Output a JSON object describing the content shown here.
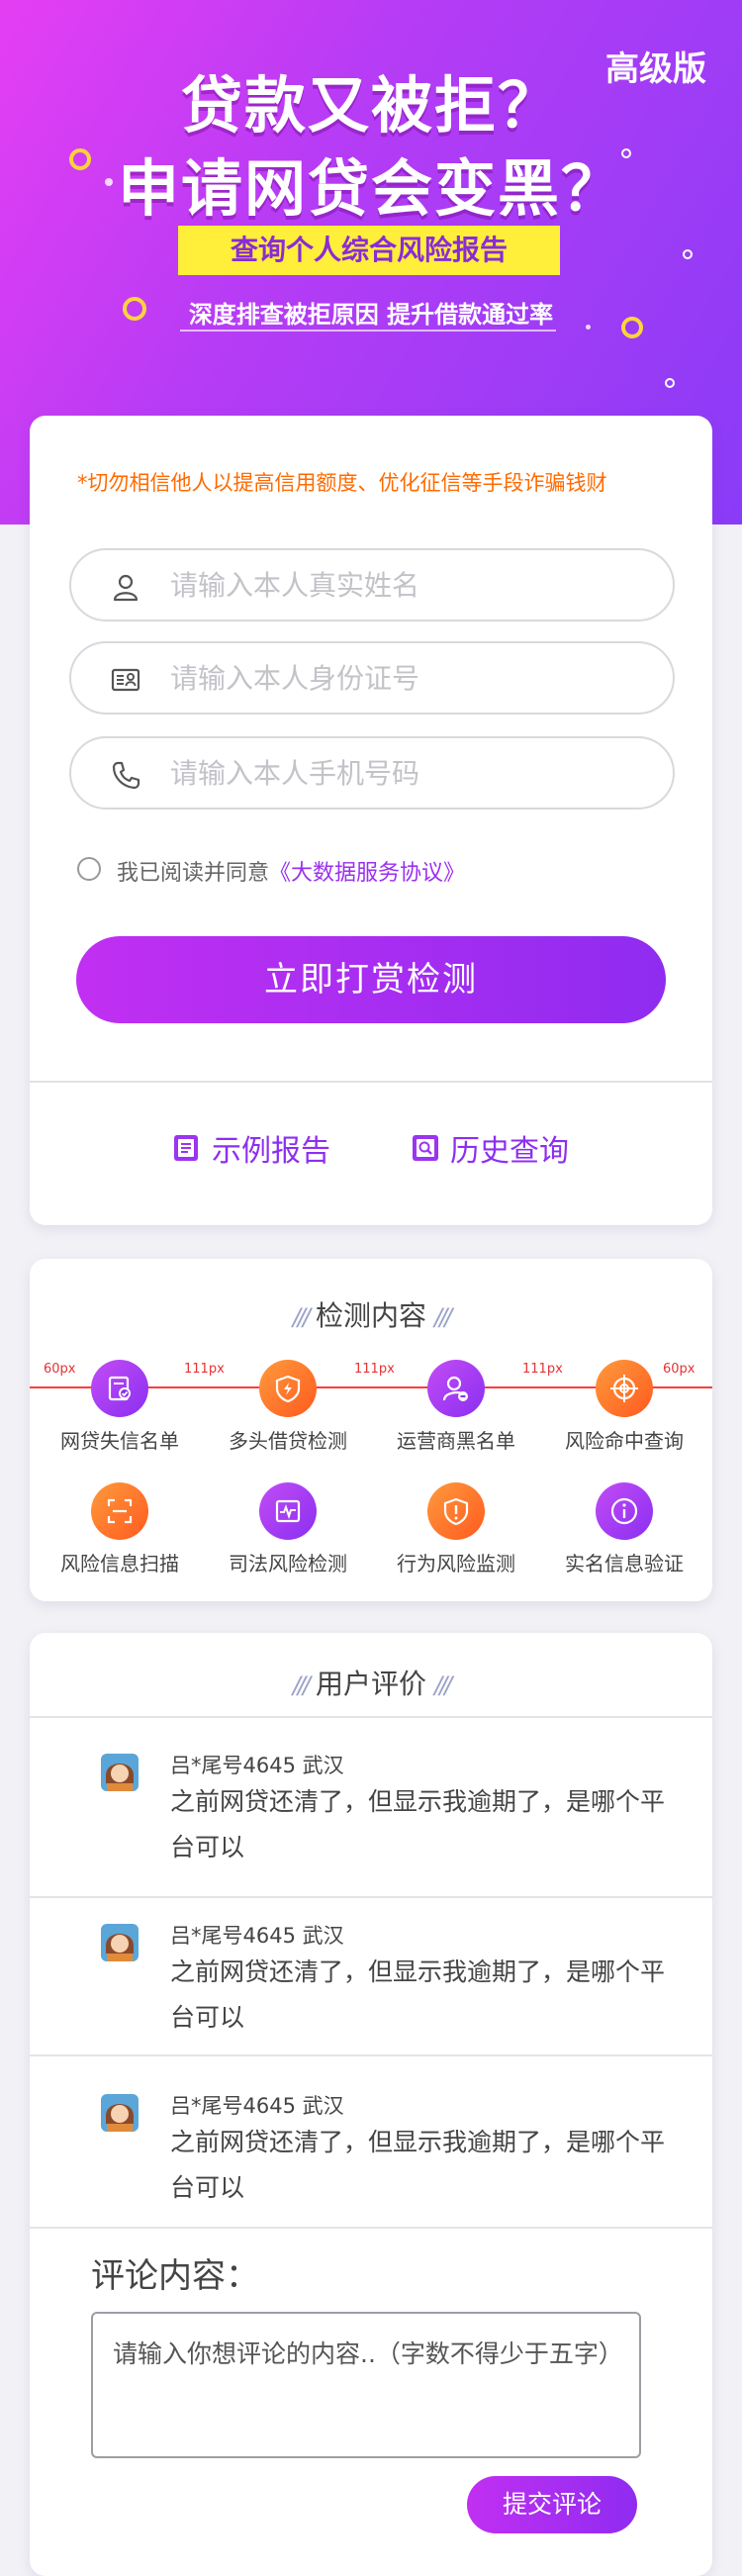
{
  "hero": {
    "edition_badge": "高级版",
    "title_line1": "贷款又被拒？",
    "title_line2": "申请网贷会变黑？",
    "banner": "查询个人综合风险报告",
    "subtitle": "深度排查被拒原因  提升借款通过率"
  },
  "form": {
    "warning": "*切勿相信他人以提高信用额度、优化征信等手段诈骗钱财",
    "name_placeholder": "请输入本人真实姓名",
    "id_placeholder": "请输入本人身份证号",
    "phone_placeholder": "请输入本人手机号码",
    "agree_text": "我已阅读并同意",
    "agree_link": "《大数据服务协议》",
    "submit_label": "立即打赏检测",
    "sample_report": "示例报告",
    "history_query": "历史查询"
  },
  "detection": {
    "title": "检测内容",
    "spacing_labels": [
      "60px",
      "111px",
      "111px",
      "111px",
      "60px"
    ],
    "items": [
      {
        "label": "网贷失信名单",
        "icon": "checklist-icon",
        "color": "#9b35f0"
      },
      {
        "label": "多头借贷检测",
        "icon": "lightning-shield-icon",
        "color": "#ff6a1f"
      },
      {
        "label": "运营商黑名单",
        "icon": "user-minus-icon",
        "color": "#9b35f0"
      },
      {
        "label": "风险命中查询",
        "icon": "crosshair-icon",
        "color": "#ff6a1f"
      },
      {
        "label": "风险信息扫描",
        "icon": "scan-icon",
        "color": "#ff6a1f"
      },
      {
        "label": "司法风险检测",
        "icon": "pulse-icon",
        "color": "#9b35f0"
      },
      {
        "label": "行为风险监测",
        "icon": "alert-shield-icon",
        "color": "#ff6a1f"
      },
      {
        "label": "实名信息验证",
        "icon": "info-icon",
        "color": "#9b35f0"
      }
    ]
  },
  "reviews": {
    "title": "用户评价",
    "items": [
      {
        "name": "吕*尾号4645  武汉",
        "text": "之前网贷还清了，但显示我逾期了，是哪个平台可以"
      },
      {
        "name": "吕*尾号4645  武汉",
        "text": "之前网贷还清了，但显示我逾期了，是哪个平台可以"
      },
      {
        "name": "吕*尾号4645  武汉",
        "text": "之前网贷还清了，但显示我逾期了，是哪个平台可以"
      }
    ],
    "comment_label": "评论内容：",
    "comment_placeholder": "请输入你想评论的内容..（字数不得少于五字）",
    "submit_comment": "提交评论"
  },
  "colors": {
    "purple": "#9b35f0",
    "orange": "#ff6a1f",
    "warning": "#ff6a00",
    "banner_yellow": "#ffee3a"
  }
}
